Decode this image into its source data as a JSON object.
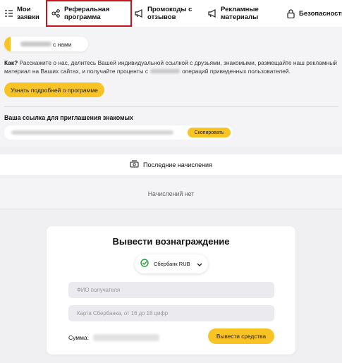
{
  "nav": {
    "items": [
      {
        "label_line1": "Мои",
        "label_line2": "заявки",
        "icon": "list-check-icon"
      },
      {
        "label_line1": "Реферальная",
        "label_line2": "программа",
        "icon": "share-icon",
        "active": true
      },
      {
        "label_line1": "Промокоды с",
        "label_line2": "отзывов",
        "icon": "megaphone-icon"
      },
      {
        "label_line1": "Рекламные",
        "label_line2": "материалы",
        "icon": "megaphone-icon"
      },
      {
        "label_line1": "Безопасность",
        "label_line2": "",
        "icon": "lock-icon"
      }
    ]
  },
  "referral": {
    "balance_suffix": "с нами",
    "how_label": "Как?",
    "how_text_1": "Расскажите о нас, делитесь Вашей индивидуальной ссылкой с друзьями, знакомыми, размещайте наш рекламный материал на Ваших сайтах, и получайте проценты с",
    "how_text_2": "операций приведенных пользователей.",
    "more_button": "Узнать подробней о программе",
    "link_title": "Ваша ссылка для приглашения знакомых",
    "copy_button": "Скопировать"
  },
  "accruals": {
    "title": "Последние начисления",
    "empty": "Начислений нет"
  },
  "withdraw": {
    "title": "Вывести вознаграждение",
    "method": "Сбербанк RUB",
    "name_placeholder": "ФИО получателя",
    "card_placeholder": "Карта Сбербанка, от 16 до 18 цифр",
    "sum_label": "Сумма:",
    "submit_button": "Вывести средства"
  },
  "colors": {
    "accent": "#f7c325",
    "active_outline": "#c4161c",
    "sber_green": "#21a038"
  }
}
